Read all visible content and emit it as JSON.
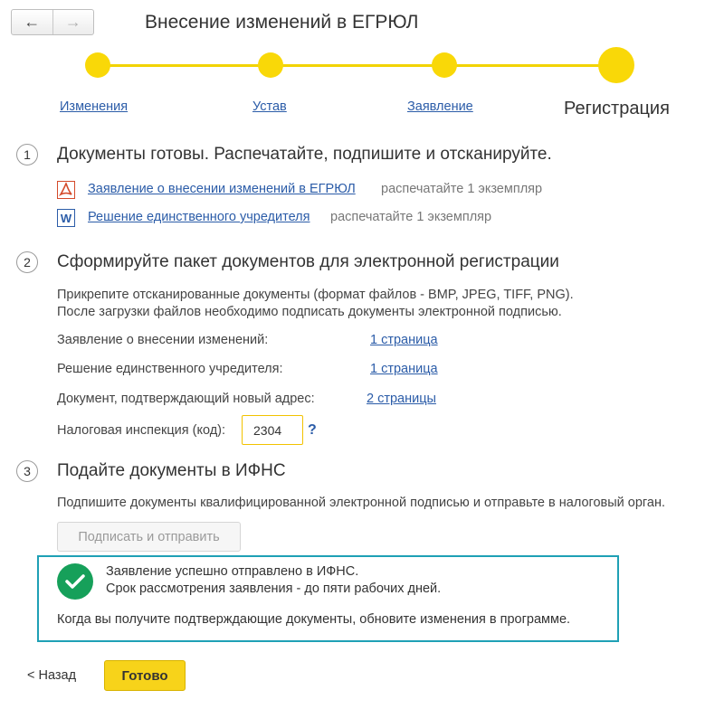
{
  "window": {
    "title": "Внесение изменений в ЕГРЮЛ",
    "back_icon": "←",
    "forward_icon": "→"
  },
  "stepper": {
    "steps": [
      {
        "label": "Изменения"
      },
      {
        "label": "Устав"
      },
      {
        "label": "Заявление"
      },
      {
        "label": "Регистрация"
      }
    ],
    "accent_color": "#f9d808"
  },
  "section1": {
    "number": "1",
    "title": "Документы готовы. Распечатайте, подпишите и отсканируйте.",
    "documents": [
      {
        "icon": "pdf-icon",
        "link": "Заявление о внесении изменений в ЕГРЮЛ",
        "hint": "распечатайте 1 экземпляр"
      },
      {
        "icon": "word-icon",
        "link": "Решение единственного учредителя",
        "hint": "распечатайте 1 экземпляр"
      }
    ]
  },
  "section2": {
    "number": "2",
    "title": "Сформируйте пакет документов для электронной регистрации",
    "description_line1": "Прикрепите отсканированные документы (формат файлов - BMP, JPEG, TIFF, PNG).",
    "description_line2": "После загрузки файлов необходимо подписать документы электронной подписью.",
    "attachments": [
      {
        "label": "Заявление о внесении изменений:",
        "pages": "1 страница"
      },
      {
        "label": "Решение единственного учредителя:",
        "pages": "1 страница"
      },
      {
        "label": "Документ, подтверждающий новый адрес:",
        "pages": "2 страницы"
      }
    ],
    "tax_office_label": "Налоговая инспекция (код):",
    "tax_office_value": "2304",
    "help_label": "?"
  },
  "section3": {
    "number": "3",
    "title": "Подайте документы в ИФНС",
    "description": "Подпишите документы квалифицированной электронной подписью и отправьте в налоговый орган.",
    "sign_button": "Подписать и отправить"
  },
  "success": {
    "line1": "Заявление успешно отправлено в ИФНС.",
    "line2": "Срок рассмотрения заявления - до пяти рабочих дней.",
    "note": "Когда вы получите подтверждающие документы, обновите изменения в программе.",
    "color": "#16a05a"
  },
  "footer": {
    "back_label": "< Назад",
    "done_label": "Готово"
  }
}
